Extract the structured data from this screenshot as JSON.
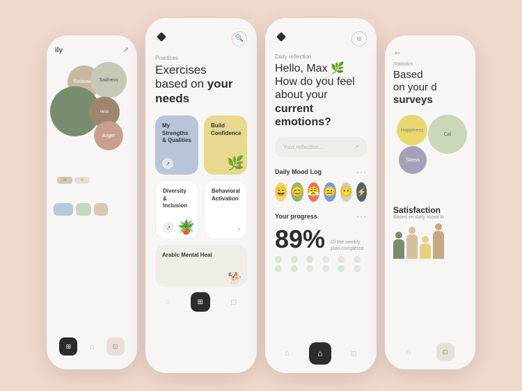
{
  "background_color": "#f0d9cc",
  "phone1": {
    "title": "ily",
    "bubbles": [
      {
        "label": "Excitement",
        "color": "#c8b8a2",
        "size": 48
      },
      {
        "label": "Sadness",
        "color": "#c0c0b0",
        "size": 52
      },
      {
        "label": "",
        "color": "#7a8c6e",
        "size": 72
      },
      {
        "label": "Stress",
        "color": "#a0856e",
        "size": 44
      },
      {
        "label": "Anger",
        "color": "#c8a090",
        "size": 42
      }
    ],
    "week_days": [
      "W",
      "M"
    ],
    "nav": {
      "icon1": "⊞",
      "icon2": "⊡"
    }
  },
  "phone2": {
    "label": "Practices",
    "title_plain": "Exercises based on ",
    "title_bold": "your needs",
    "cards": [
      {
        "title": "My Strengths & Qualities",
        "color": "#b8c4d8"
      },
      {
        "title": "Build Confidence",
        "color": "#e8d890"
      },
      {
        "title": "Diversity & Inclusion",
        "color": "#ffffff"
      },
      {
        "title": "Behavioral Activation",
        "color": "#ffffff"
      },
      {
        "title": "Arabic Mental Heal",
        "color": "#f0ece6"
      }
    ],
    "header": {
      "icon": "◆",
      "search": "○"
    }
  },
  "phone3": {
    "label": "Daily reflection",
    "greeting": "Hello, Max 🌿",
    "question_plain": "How do you feel about your ",
    "question_bold": "current emotions?",
    "reflection_placeholder": "Your reflection...",
    "mood_log_label": "Daily Mood Log",
    "progress_label": "Your progress",
    "progress_value": "89%",
    "progress_desc": "Of the weekly plan completed",
    "moods": [
      "😄",
      "😊",
      "😤",
      "😐",
      "😶",
      "⚡"
    ],
    "header": {
      "icon": "◆",
      "target": "◎"
    }
  },
  "phone4": {
    "back": "←",
    "label": "Statistics",
    "title_line1": "Based",
    "title_line2": "on your d",
    "title_line3": "surveys",
    "title_bold_part": "surveys",
    "bubbles": [
      {
        "label": "Happiness",
        "color": "#e8d870"
      },
      {
        "label": "Cal",
        "color": "#c8d8b8"
      },
      {
        "label": "Stress",
        "color": "#a8a0b8"
      }
    ],
    "satisfaction_title": "Satisfaction",
    "satisfaction_sub": "Based on daily mood lo"
  }
}
